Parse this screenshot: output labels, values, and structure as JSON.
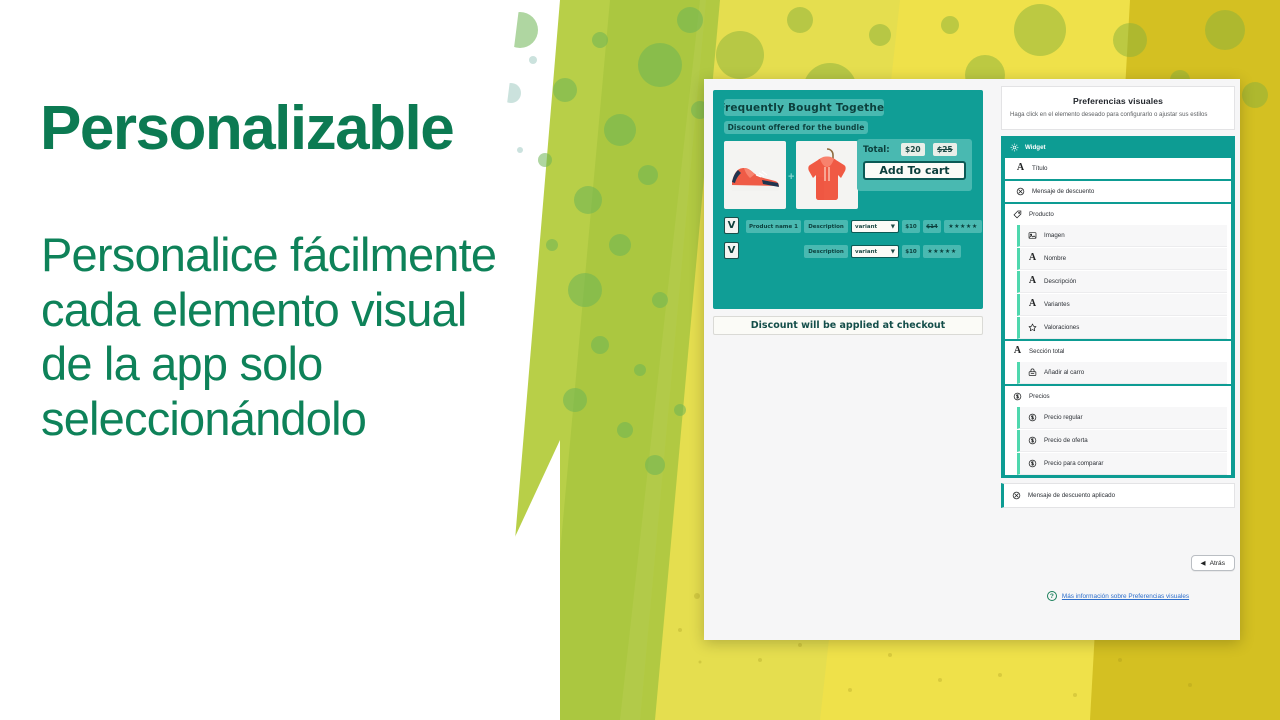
{
  "theme": {
    "brand_green": "#0c7a52",
    "teal": "#0d9c93",
    "widget_teal": "#109e96",
    "yellow": "#d4c022",
    "lime": "#a9c63f",
    "link_blue": "#2c6ecb",
    "mint": "#4fd8ae"
  },
  "marketing": {
    "headline": "Personalizable",
    "subcopy": "Personalice fácilmente cada elemento visual de la app solo seleccionándolo"
  },
  "app": {
    "preview": {
      "title": "Frequently Bought Together",
      "subtitle": "Discount offered for the bundle",
      "plus": "+",
      "checkbox_mark": "V",
      "total_label": "Total:",
      "price_bundle": "$20",
      "price_compare": "$25",
      "add_to_cart": "Add To cart",
      "footer_note": "Discount will be applied at checkout",
      "products": [
        {
          "name": "Product name 1",
          "description": "Description",
          "variant": "variant",
          "variant_caret": "▼",
          "price": "$10",
          "compare_price": "$14",
          "rating": "★★★★★"
        },
        {
          "name": "",
          "description": "Description",
          "variant": "variant",
          "variant_caret": "▼",
          "price": "$10",
          "compare_price": "",
          "rating": "★★★★★"
        }
      ]
    },
    "settings": {
      "title": "Preferencias visuales",
      "description": "Haga click en el elemento deseado para configurarlo o ajustar sus estilos",
      "tree": {
        "group_label": "Widget",
        "group_icon": "gear-icon",
        "items": [
          {
            "label": "Título",
            "icon": "text-icon",
            "level": 1
          },
          {
            "label": "Mensaje de descuento",
            "icon": "discount-icon",
            "level": 1
          }
        ],
        "product_section": {
          "label": "Producto",
          "icon": "tag-icon",
          "children": [
            {
              "label": "Imagen",
              "icon": "image-icon"
            },
            {
              "label": "Nombre",
              "icon": "text-icon"
            },
            {
              "label": "Descripción",
              "icon": "text-icon"
            },
            {
              "label": "Variantes",
              "icon": "text-icon"
            },
            {
              "label": "Valoraciones",
              "icon": "star-icon"
            }
          ]
        },
        "total_section": {
          "label": "Sección total",
          "icon": "text-icon",
          "children": [
            {
              "label": "Añadir al carro",
              "icon": "cart-button-icon"
            }
          ]
        },
        "prices_section": {
          "label": "Precios",
          "icon": "money-icon",
          "children": [
            {
              "label": "Precio regular",
              "icon": "money-icon"
            },
            {
              "label": "Precio de oferta",
              "icon": "money-icon"
            },
            {
              "label": "Precio para comparar",
              "icon": "money-icon"
            }
          ]
        },
        "standalone": {
          "label": "Mensaje de descuento aplicado",
          "icon": "discount-icon"
        }
      },
      "back_button": {
        "label": "Atrás",
        "icon": "caret-left-icon"
      },
      "help": {
        "label": "Más información sobre Preferencias visuales",
        "icon": "question-icon",
        "glyph": "?"
      }
    }
  }
}
